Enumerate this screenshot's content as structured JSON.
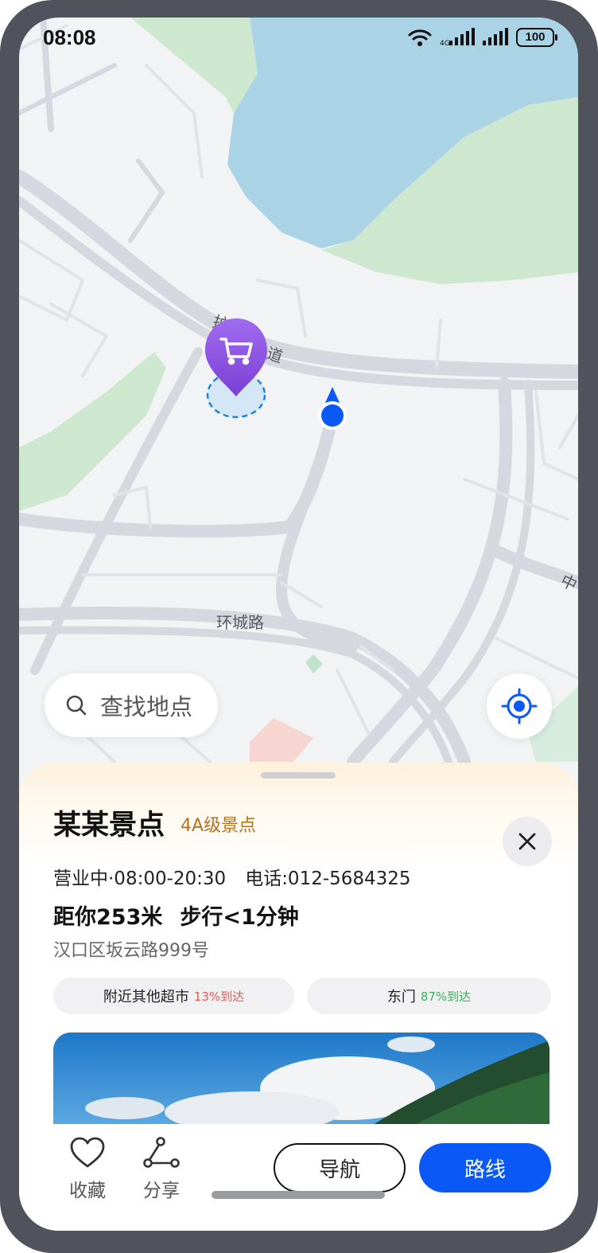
{
  "status_bar": {
    "time": "08:08",
    "battery": "100",
    "icons": [
      "wifi-icon",
      "signal-icon",
      "signal-icon",
      "battery-icon"
    ]
  },
  "map": {
    "road_labels": {
      "main": "环城路",
      "partial_road": "道",
      "partial_left": "护",
      "partial_right": "中"
    },
    "colors": {
      "water": "#aad3e6",
      "park": "#cde8cf",
      "land": "#f2f3f5",
      "road": "#dcdde3",
      "poi_pin": "#8e54e0",
      "user": "#0a59f7"
    }
  },
  "search": {
    "placeholder": "查找地点",
    "icon": "search-icon"
  },
  "locate_button": {
    "icon": "locate-icon"
  },
  "place": {
    "name": "某某景点",
    "badge": "4A级景点",
    "hours": "营业中·08:00-20:30",
    "phone": "电话:012-5684325",
    "distance": "距你253米",
    "walk_time": "步行<1分钟",
    "address": "汉口区坂云路999号",
    "chips": [
      {
        "label": "附近其他超市",
        "pct": "13%到达",
        "pct_color": "#e05a5a"
      },
      {
        "label": "东门",
        "pct": "87%到达",
        "pct_color": "#3cae5c"
      }
    ]
  },
  "actions": {
    "favorite": "收藏",
    "share": "分享",
    "navigate": "导航",
    "route": "路线"
  }
}
